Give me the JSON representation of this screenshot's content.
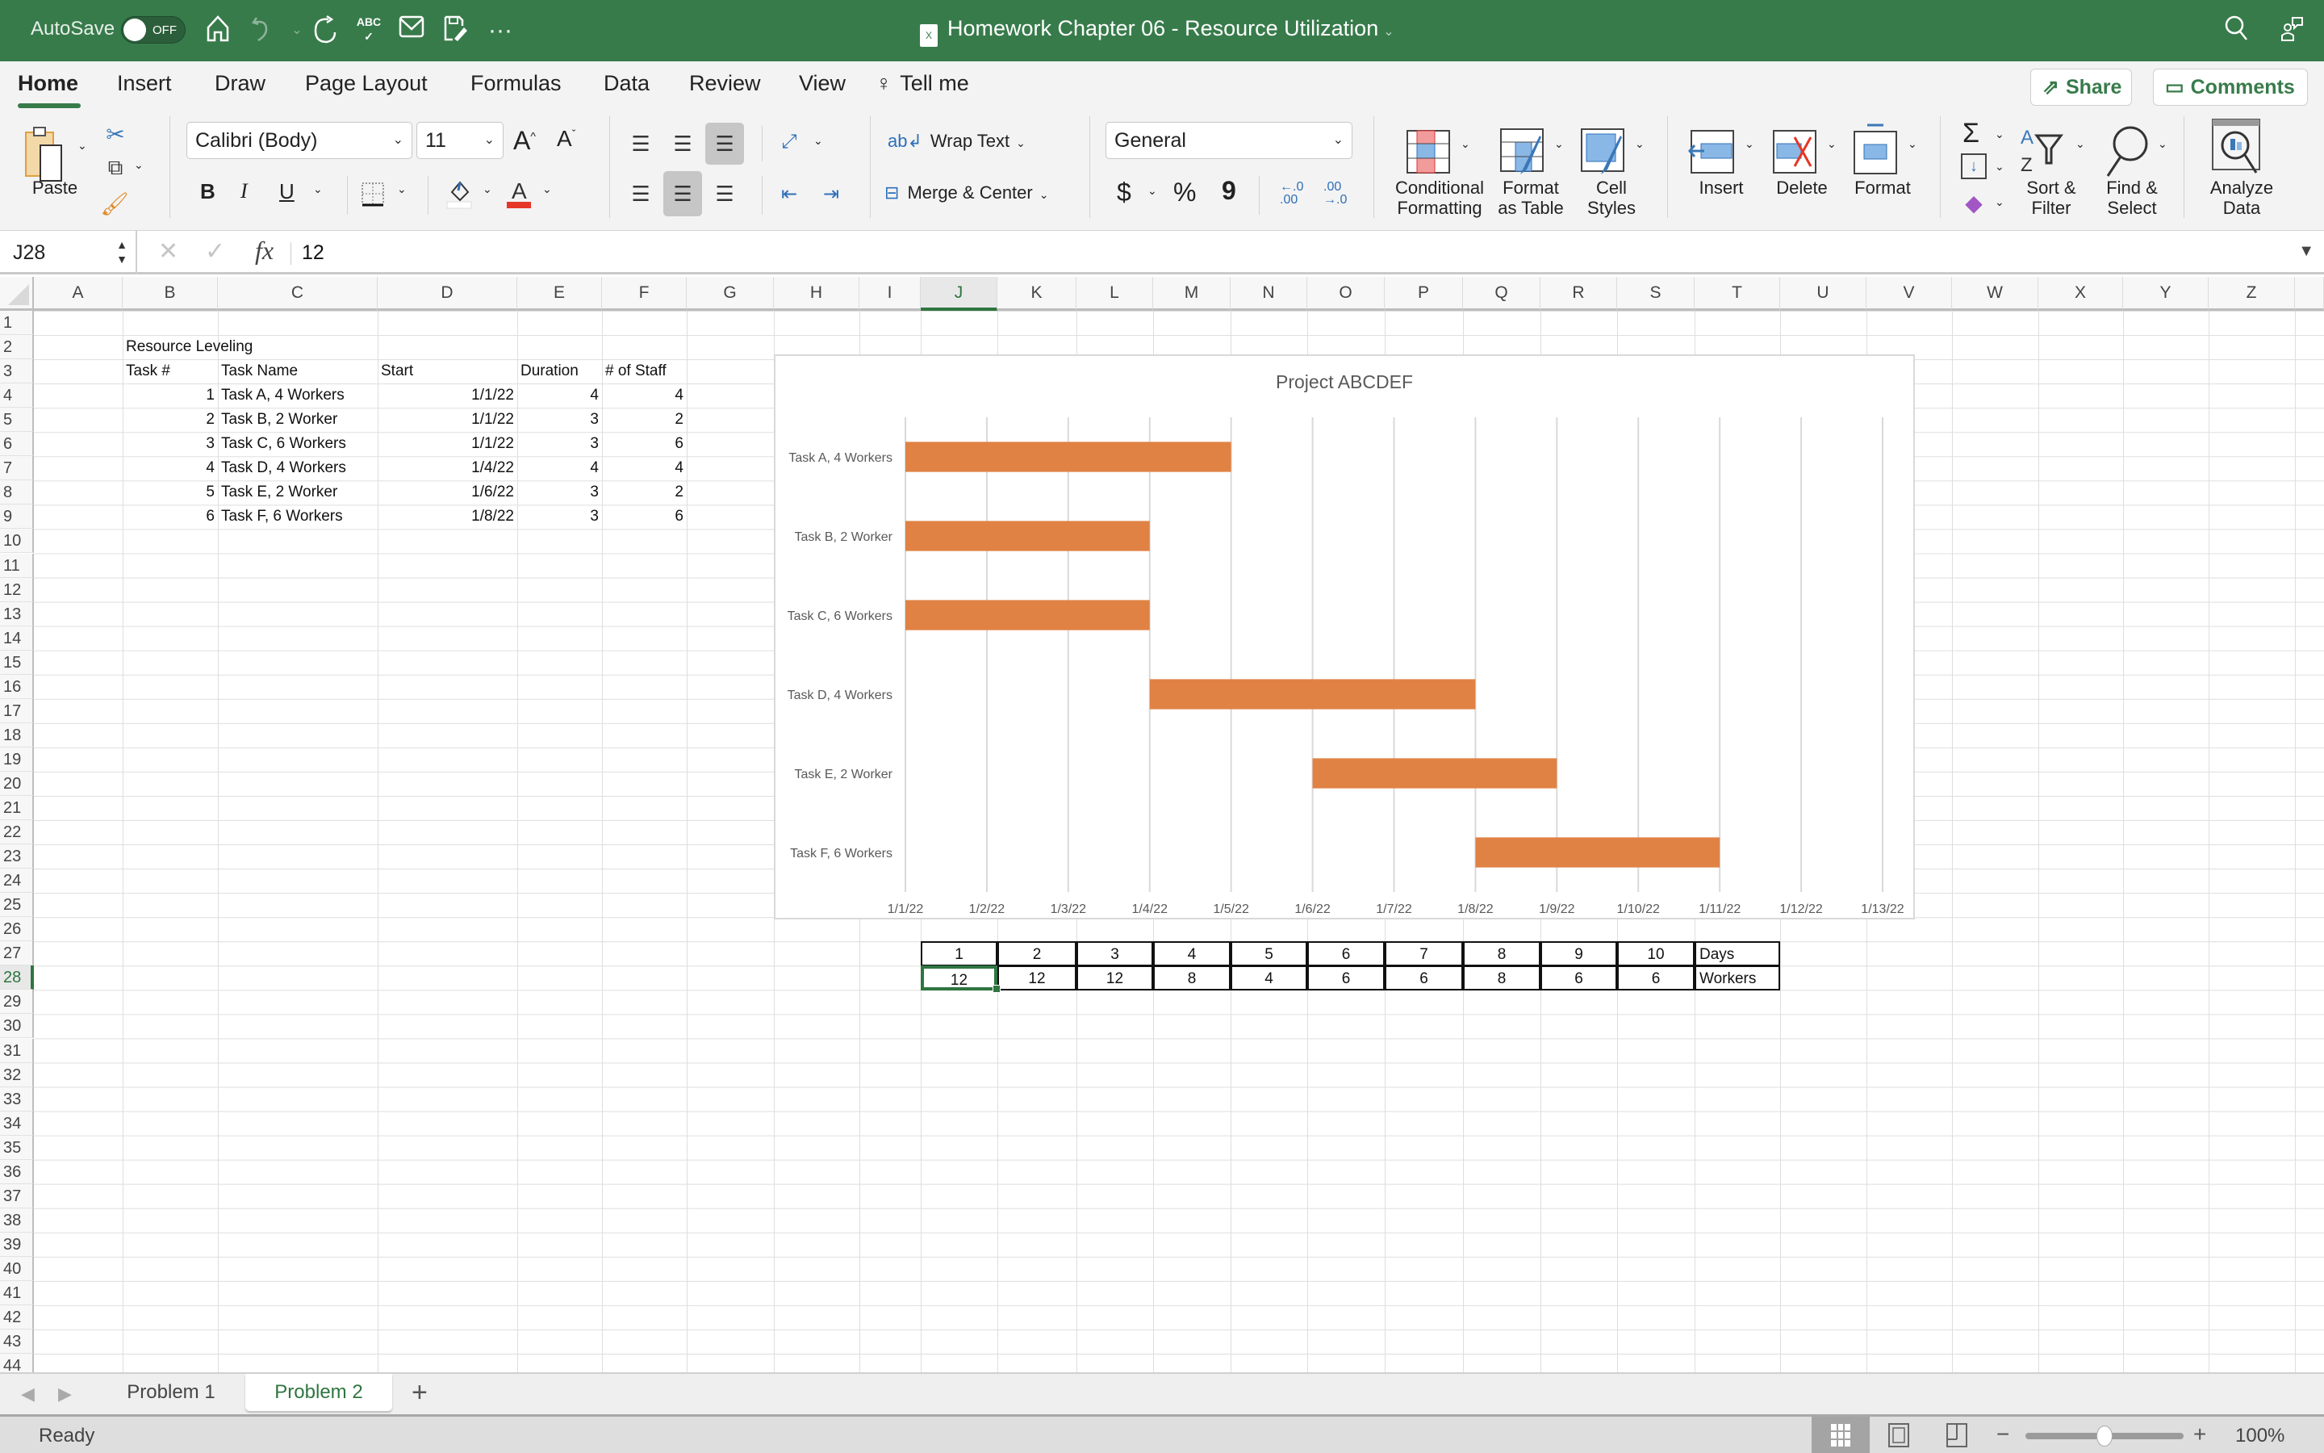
{
  "titlebar": {
    "autosave_label": "AutoSave",
    "autosave_state": "OFF",
    "doc_title": "Homework Chapter 06 - Resource Utilization",
    "icons": [
      "home-icon",
      "undo-icon",
      "redo-icon",
      "spelling-icon",
      "email-icon",
      "save-as-icon",
      "more-icon",
      "search-icon",
      "share-people-icon"
    ]
  },
  "ribbon": {
    "tabs": [
      "Home",
      "Insert",
      "Draw",
      "Page Layout",
      "Formulas",
      "Data",
      "Review",
      "View"
    ],
    "active_tab": "Home",
    "tell_me": "Tell me",
    "share": "Share",
    "comments": "Comments",
    "paste": "Paste",
    "font_name": "Calibri (Body)",
    "font_size": "11",
    "wrap_text": "Wrap Text",
    "merge_center": "Merge & Center",
    "number_format": "General",
    "conditional_formatting": [
      "Conditional",
      "Formatting"
    ],
    "format_as_table": [
      "Format",
      "as Table"
    ],
    "cell_styles": [
      "Cell",
      "Styles"
    ],
    "insert": "Insert",
    "delete": "Delete",
    "format": "Format",
    "sort_filter": [
      "Sort &",
      "Filter"
    ],
    "find_select": [
      "Find &",
      "Select"
    ],
    "analyze_data": [
      "Analyze",
      "Data"
    ],
    "bold": "B",
    "italic": "I",
    "underline": "U",
    "currency": "$",
    "percent": "%",
    "comma": "9"
  },
  "formula_bar": {
    "name_box": "J28",
    "fx": "fx",
    "value": "12"
  },
  "grid": {
    "columns": [
      "A",
      "B",
      "C",
      "D",
      "E",
      "F",
      "G",
      "H",
      "I",
      "J",
      "K",
      "L",
      "M",
      "N",
      "O",
      "P",
      "Q",
      "R",
      "S",
      "T",
      "U",
      "V",
      "W",
      "X",
      "Y",
      "Z"
    ],
    "selected_column": "J",
    "row_count": 44,
    "selected_row": 28
  },
  "table": {
    "title": "Resource Leveling",
    "headers": [
      "Task #",
      "Task Name",
      "Start",
      "Duration",
      "# of Staff"
    ],
    "rows": [
      [
        "1",
        "Task A, 4 Workers",
        "1/1/22",
        "4",
        "4"
      ],
      [
        "2",
        "Task B, 2 Worker",
        "1/1/22",
        "3",
        "2"
      ],
      [
        "3",
        "Task C, 6 Workers",
        "1/1/22",
        "3",
        "6"
      ],
      [
        "4",
        "Task D, 4 Workers",
        "1/4/22",
        "4",
        "4"
      ],
      [
        "5",
        "Task E, 2 Worker",
        "1/6/22",
        "3",
        "2"
      ],
      [
        "6",
        "Task F, 6 Workers",
        "1/8/22",
        "3",
        "6"
      ]
    ]
  },
  "workers_table": {
    "days": [
      "1",
      "2",
      "3",
      "4",
      "5",
      "6",
      "7",
      "8",
      "9",
      "10"
    ],
    "days_label": "Days",
    "workers": [
      "12",
      "12",
      "12",
      "8",
      "4",
      "6",
      "6",
      "8",
      "6",
      "6"
    ],
    "workers_label": "Workers"
  },
  "chart_data": {
    "type": "bar",
    "orientation": "horizontal-gantt",
    "title": "Project ABCDEF",
    "categories": [
      "Task A, 4 Workers",
      "Task B, 2 Worker",
      "Task C, 6 Workers",
      "Task D, 4 Workers",
      "Task E, 2 Worker",
      "Task F, 6 Workers"
    ],
    "series": [
      {
        "name": "Start (offset day index)",
        "values": [
          0,
          0,
          0,
          3,
          5,
          7
        ]
      },
      {
        "name": "Duration",
        "values": [
          4,
          3,
          3,
          4,
          3,
          3
        ]
      }
    ],
    "x_ticks": [
      "1/1/22",
      "1/2/22",
      "1/3/22",
      "1/4/22",
      "1/5/22",
      "1/6/22",
      "1/7/22",
      "1/8/22",
      "1/9/22",
      "1/10/22",
      "1/11/22",
      "1/12/22",
      "1/13/22"
    ],
    "xlim": [
      0,
      12
    ],
    "grid": "vertical",
    "bar_color": "#e08244",
    "legend": "none"
  },
  "sheets": {
    "tabs": [
      "Problem 1",
      "Problem 2"
    ],
    "active": "Problem 2",
    "add": "+"
  },
  "status": {
    "text": "Ready",
    "zoom": "100%",
    "zoom_fraction": 0.5
  }
}
